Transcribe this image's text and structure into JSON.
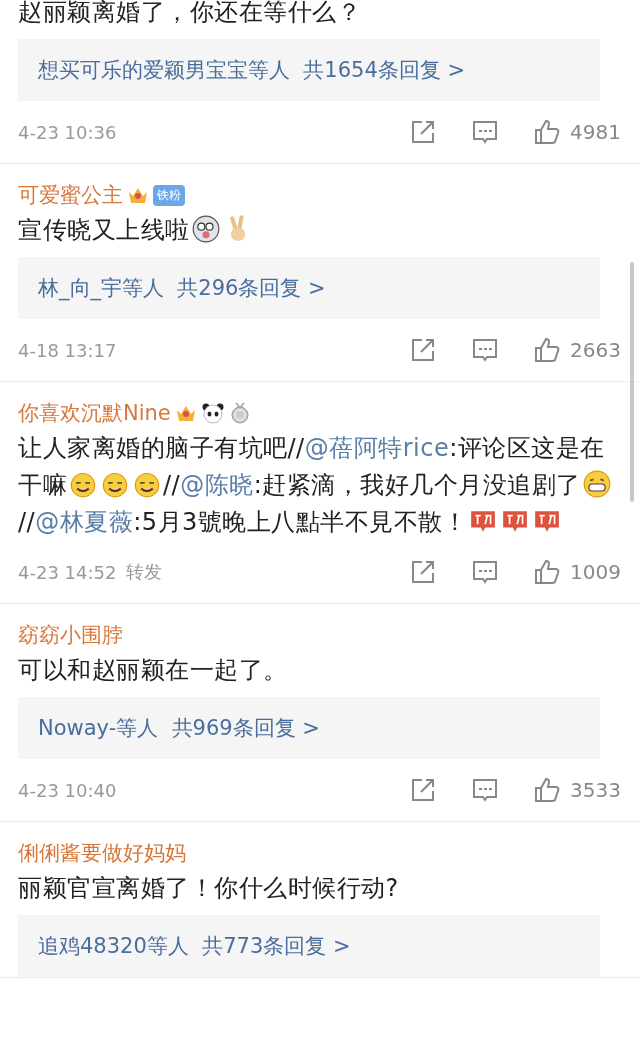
{
  "comments": [
    {
      "text": [
        {
          "kind": "text",
          "text": "赵丽颖离婚了，你还在等什么？"
        }
      ],
      "replies": {
        "label": "想买可乐的爱颖男宝宝等人  共1654条回复 >"
      },
      "time": "4-23 10:36",
      "like_count": "4981"
    },
    {
      "user": {
        "name": "可爱蜜公主",
        "badges": [
          {
            "kind": "crown"
          },
          {
            "kind": "fan",
            "label": "铁粉"
          }
        ]
      },
      "text": [
        {
          "kind": "text",
          "text": "宣传晓又上线啦"
        },
        {
          "kind": "dog"
        },
        {
          "kind": "victory"
        }
      ],
      "replies": {
        "label": "林_向_宇等人  共296条回复 >"
      },
      "time": "4-18 13:17",
      "like_count": "2663"
    },
    {
      "user": {
        "name": "你喜欢沉默Nine",
        "badges": [
          {
            "kind": "crown"
          },
          {
            "kind": "panda"
          },
          {
            "kind": "medal"
          }
        ]
      },
      "text": [
        {
          "kind": "text",
          "text": "让人家离婚的脑子有坑吧//"
        },
        {
          "kind": "mention",
          "text": "@蓓阿特rice"
        },
        {
          "kind": "text",
          "text": ":评论区这是在干嘛"
        },
        {
          "kind": "smug"
        },
        {
          "kind": "smug"
        },
        {
          "kind": "smug"
        },
        {
          "kind": "text",
          "text": "//"
        },
        {
          "kind": "mention",
          "text": "@陈晓"
        },
        {
          "kind": "text",
          "text": ":赶紧滴，我好几个月没追剧了"
        },
        {
          "kind": "grin"
        },
        {
          "kind": "text",
          "text": "//"
        },
        {
          "kind": "mention",
          "text": "@林夏薇"
        },
        {
          "kind": "text",
          "text": ":5月3號晚上八點半不見不散！"
        },
        {
          "kind": "cheer"
        },
        {
          "kind": "cheer"
        },
        {
          "kind": "cheer"
        }
      ],
      "time": "4-23 14:52",
      "tag": "转发",
      "like_count": "1009"
    },
    {
      "user": {
        "name": "窈窈小围脖"
      },
      "text": [
        {
          "kind": "text",
          "text": "可以和赵丽颖在一起了。"
        }
      ],
      "replies": {
        "label": "Noway-等人  共969条回复 >"
      },
      "time": "4-23 10:40",
      "like_count": "3533"
    },
    {
      "user": {
        "name": "俐俐酱要做好妈妈"
      },
      "text": [
        {
          "kind": "text",
          "text": "丽颖官宣离婚了！你什么时候行动?"
        }
      ],
      "replies": {
        "label": "追鸡48320等人  共773条回复 >"
      }
    }
  ]
}
